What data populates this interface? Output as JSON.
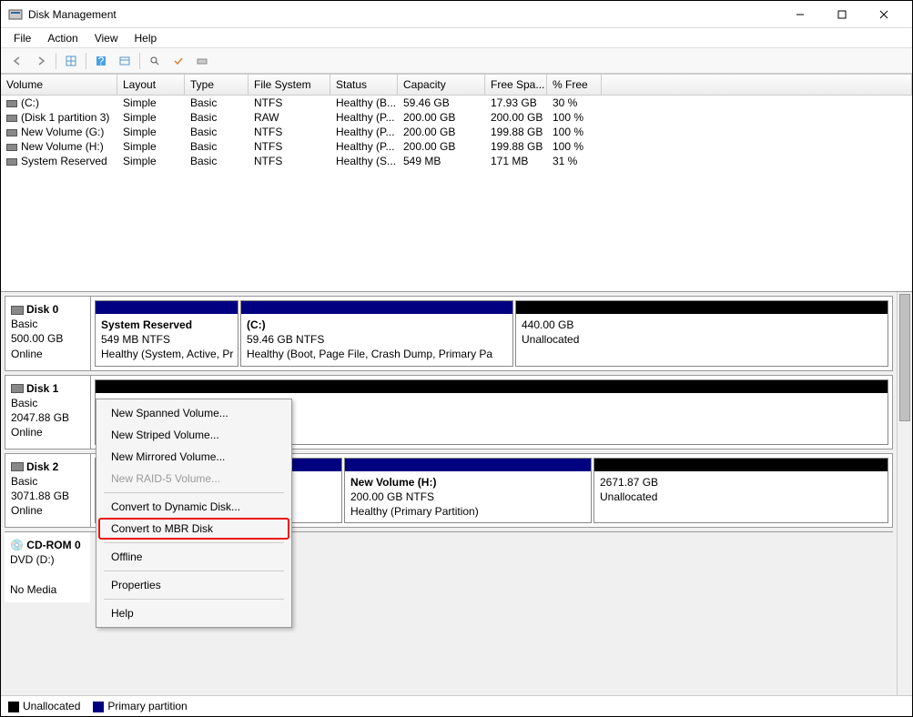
{
  "window": {
    "title": "Disk Management"
  },
  "menu": {
    "file": "File",
    "action": "Action",
    "view": "View",
    "help": "Help"
  },
  "columns": [
    "Volume",
    "Layout",
    "Type",
    "File System",
    "Status",
    "Capacity",
    "Free Spa...",
    "% Free"
  ],
  "volumes": [
    {
      "name": "(C:)",
      "layout": "Simple",
      "type": "Basic",
      "fs": "NTFS",
      "status": "Healthy (B...",
      "capacity": "59.46 GB",
      "free": "17.93 GB",
      "pct": "30 %"
    },
    {
      "name": "(Disk 1 partition 3)",
      "layout": "Simple",
      "type": "Basic",
      "fs": "RAW",
      "status": "Healthy (P...",
      "capacity": "200.00 GB",
      "free": "200.00 GB",
      "pct": "100 %"
    },
    {
      "name": "New Volume (G:)",
      "layout": "Simple",
      "type": "Basic",
      "fs": "NTFS",
      "status": "Healthy (P...",
      "capacity": "200.00 GB",
      "free": "199.88 GB",
      "pct": "100 %"
    },
    {
      "name": "New Volume (H:)",
      "layout": "Simple",
      "type": "Basic",
      "fs": "NTFS",
      "status": "Healthy (P...",
      "capacity": "200.00 GB",
      "free": "199.88 GB",
      "pct": "100 %"
    },
    {
      "name": "System Reserved",
      "layout": "Simple",
      "type": "Basic",
      "fs": "NTFS",
      "status": "Healthy (S...",
      "capacity": "549 MB",
      "free": "171 MB",
      "pct": "31 %"
    }
  ],
  "disks": {
    "d0": {
      "name": "Disk 0",
      "type": "Basic",
      "size": "500.00 GB",
      "state": "Online",
      "p0": {
        "title": "System Reserved",
        "line2": "549 MB NTFS",
        "line3": "Healthy (System, Active, Pr"
      },
      "p1": {
        "title": "(C:)",
        "line2": "59.46 GB NTFS",
        "line3": "Healthy (Boot, Page File, Crash Dump, Primary Pa"
      },
      "p2": {
        "title": "",
        "line2": "440.00 GB",
        "line3": "Unallocated"
      }
    },
    "d1": {
      "name": "Disk 1",
      "type": "Basic",
      "size": "2047.88 GB",
      "state": "Online"
    },
    "d2": {
      "name": "Disk 2",
      "type": "Basic",
      "size": "3071.88 GB",
      "state": "Online",
      "p1": {
        "title": "New Volume  (H:)",
        "line2": "200.00 GB NTFS",
        "line3": "Healthy (Primary Partition)"
      },
      "p2": {
        "title": "",
        "line2": "2671.87 GB",
        "line3": "Unallocated"
      }
    },
    "cd": {
      "name": "CD-ROM 0",
      "type": "DVD (D:)",
      "state": "No Media"
    }
  },
  "legend": {
    "unalloc": "Unallocated",
    "primary": "Primary partition"
  },
  "context_menu": {
    "spanned": "New Spanned Volume...",
    "striped": "New Striped Volume...",
    "mirrored": "New Mirrored Volume...",
    "raid5": "New RAID-5 Volume...",
    "dynamic": "Convert to Dynamic Disk...",
    "mbr": "Convert to MBR Disk",
    "offline": "Offline",
    "properties": "Properties",
    "help": "Help"
  }
}
